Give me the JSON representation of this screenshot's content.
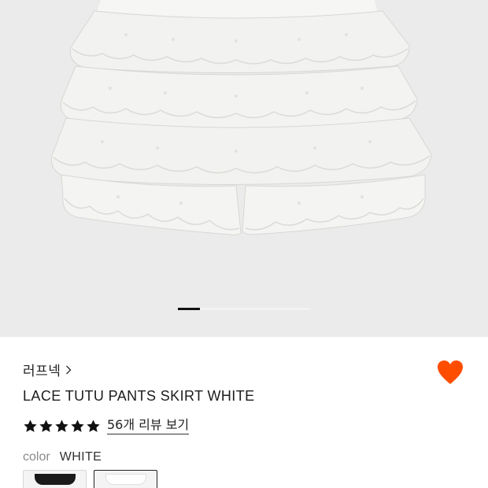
{
  "gallery": {
    "image": "lace-tutu-pants-skirt-white-photo",
    "page_count": 5,
    "current_page": 1
  },
  "product": {
    "brand": "러프넥",
    "brand_chevron": "chevron-right-icon",
    "title": "LACE TUTU PANTS SKIRT WHITE",
    "favorite_icon": "heart-icon",
    "favorite_color": "#ff4d00",
    "rating": 5,
    "review_link": "56개 리뷰 보기",
    "color_label": "color",
    "color_value": "WHITE"
  },
  "swatches": [
    {
      "name": "BLACK",
      "color": "#1a1a1a",
      "selected": false
    },
    {
      "name": "WHITE",
      "color": "#ffffff",
      "selected": true
    }
  ]
}
